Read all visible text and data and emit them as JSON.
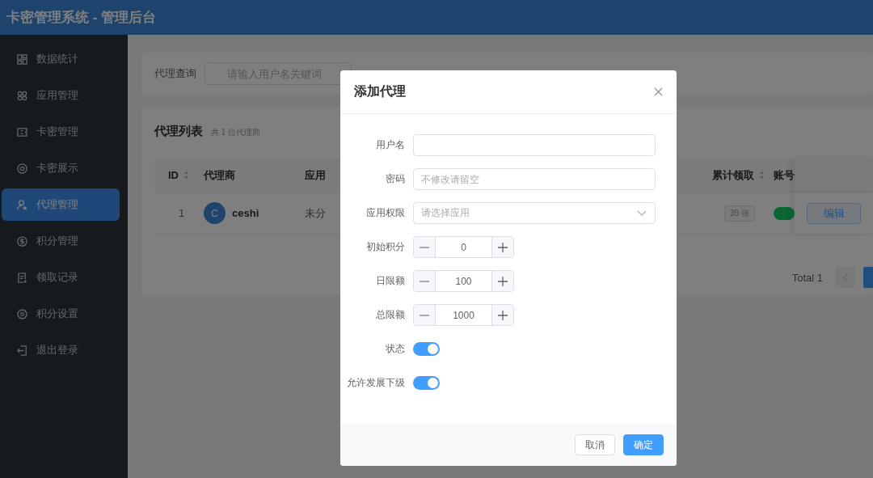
{
  "header": {
    "title": "卡密管理系统 - 管理后台"
  },
  "sidebar": {
    "items": [
      {
        "label": "数据统计",
        "selected": false
      },
      {
        "label": "应用管理",
        "selected": false
      },
      {
        "label": "卡密管理",
        "selected": false
      },
      {
        "label": "卡密展示",
        "selected": false
      },
      {
        "label": "代理管理",
        "selected": true
      },
      {
        "label": "积分管理",
        "selected": false
      },
      {
        "label": "领取记录",
        "selected": false
      },
      {
        "label": "积分设置",
        "selected": false
      },
      {
        "label": "退出登录",
        "selected": false
      }
    ]
  },
  "search": {
    "label": "代理查询",
    "placeholder": "请输入用户名关键词"
  },
  "list": {
    "title": "代理列表",
    "count": "共 1 位代理商",
    "left_columns": [
      {
        "label": "ID",
        "sortable": true
      },
      {
        "label": "代理商",
        "sortable": false
      },
      {
        "label": "应用",
        "sortable": false
      }
    ],
    "right_columns": [
      {
        "label": "累计领取",
        "sortable": true
      },
      {
        "label": "账号",
        "sortable": false
      }
    ],
    "rows": [
      {
        "id": "1",
        "avatar": "C",
        "name": "ceshi",
        "apps": "未分",
        "claimed": "39 张",
        "account_on": true,
        "action": "编辑"
      }
    ],
    "pagination": {
      "total": "Total 1"
    }
  },
  "dialog": {
    "title": "添加代理",
    "fields": [
      {
        "kind": "text",
        "label": "用户名"
      },
      {
        "kind": "text",
        "label": "密码",
        "placeholder": "不修改请留空"
      },
      {
        "kind": "select",
        "label": "应用权限",
        "placeholder": "请选择应用"
      },
      {
        "kind": "number",
        "label": "初始积分",
        "value": "0"
      },
      {
        "kind": "number",
        "label": "日限额",
        "value": "100"
      },
      {
        "kind": "number",
        "label": "总限额",
        "value": "1000"
      },
      {
        "kind": "switch",
        "label": "状态",
        "on": true
      },
      {
        "kind": "switch",
        "label": "允许发展下级",
        "on": true
      }
    ],
    "buttons": [
      {
        "label": "取消",
        "primary": false
      },
      {
        "label": "确定",
        "primary": true
      }
    ]
  }
}
